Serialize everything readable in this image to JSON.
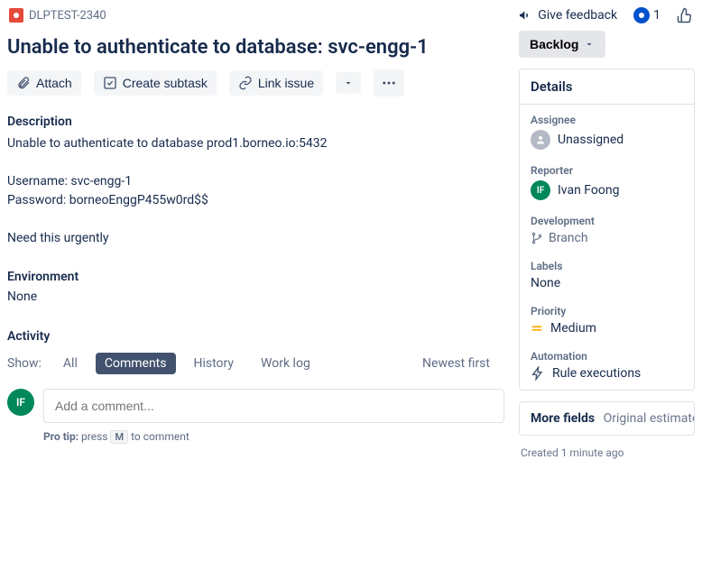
{
  "header": {
    "issue_key": "DLPTEST-2340",
    "feedback": "Give feedback",
    "watch_count": "1"
  },
  "issue": {
    "title": "Unable to authenticate to database: svc-engg-1"
  },
  "toolbar": {
    "attach": "Attach",
    "create_subtask": "Create subtask",
    "link": "Link issue"
  },
  "description": {
    "label": "Description",
    "body": "Unable to authenticate to database prod1.borneo.io:5432\n\nUsername: svc-engg-1\nPassword: borneoEnggP455w0rd$$\n\nNeed this urgently"
  },
  "environment": {
    "label": "Environment",
    "value": "None"
  },
  "activity": {
    "label": "Activity",
    "show_label": "Show:",
    "tabs": {
      "all": "All",
      "comments": "Comments",
      "history": "History",
      "worklog": "Work log"
    },
    "newest_first": "Newest first",
    "comment_placeholder": "Add a comment...",
    "avatar_initials": "IF",
    "pro_tip_prefix": "Pro tip:",
    "pro_tip_text_before": " press ",
    "pro_tip_key": "M",
    "pro_tip_text_after": " to comment"
  },
  "sidebar": {
    "status": "Backlog",
    "details_title": "Details",
    "assignee": {
      "label": "Assignee",
      "value": "Unassigned"
    },
    "reporter": {
      "label": "Reporter",
      "value": "Ivan Foong",
      "initials": "IF"
    },
    "development": {
      "label": "Development",
      "branch": "Branch"
    },
    "labels": {
      "label": "Labels",
      "value": "None"
    },
    "priority": {
      "label": "Priority",
      "value": "Medium"
    },
    "automation": {
      "label": "Automation",
      "value": "Rule executions"
    },
    "more_fields": {
      "label": "More fields",
      "rest": "Original estimate, Tim"
    },
    "created": "Created 1 minute ago"
  }
}
